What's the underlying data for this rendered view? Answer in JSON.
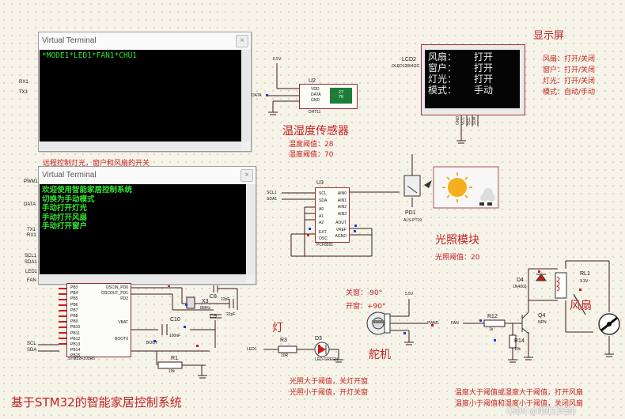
{
  "terminal1": {
    "title": "Virtual Terminal",
    "close": "×",
    "output": "*MODE1*LED1*FAN1*CHU1"
  },
  "terminal2": {
    "title": "Virtual Terminal",
    "close": "×",
    "lines": [
      "欢迎使用智能家居控制系统",
      "切换为手动模式",
      "手动打开灯光",
      "手动打开风扇",
      "手动打开窗户"
    ]
  },
  "notes": {
    "remote_control": "远程控制灯光，窗户和风扇的开关",
    "system_title": "基于STM32的智能家居控制系统",
    "display_title": "显示屏",
    "temp_sensor_title": "温湿度传感器",
    "temp_threshold": "温度阈值：28",
    "hum_threshold": "湿度阈值：70",
    "light_module_title": "光照模块",
    "light_threshold": "光照阈值：20",
    "lamp_title": "灯",
    "servo_title": "舵机",
    "close_window": "关窗：-90°",
    "open_window": "开窗：+90°",
    "light_rule_1": "光照大于阈值，关灯开窗",
    "light_rule_2": "光照小于阈值，开灯关窗",
    "fan_title": "风扇",
    "fan_rule_1": "温度大于阈值或湿度大于阈值，打开风扇",
    "fan_rule_2": "温度小于阈值和湿度小于阈值，关闭风扇",
    "watermark": "CSDN @科创工作室li"
  },
  "legend": [
    {
      "key": "风扇：",
      "val": "打开/关闭"
    },
    {
      "key": "窗户：",
      "val": "打开/关闭"
    },
    {
      "key": "灯光：",
      "val": "打开/关闭"
    },
    {
      "key": "模式：",
      "val": "自动/手动"
    }
  ],
  "lcd": {
    "ref": "LCD2",
    "part": "OLED12864I2C",
    "rows": [
      {
        "k": "风扇：",
        "v": "打开"
      },
      {
        "k": "窗户：",
        "v": "打开"
      },
      {
        "k": "灯光：",
        "v": "打开"
      },
      {
        "k": "模式：",
        "v": "手动"
      }
    ],
    "pins": [
      "GND",
      "VCC",
      "SCL",
      "SDA"
    ]
  },
  "dht": {
    "ref": "U2",
    "part": "DHT11",
    "pins": [
      "VDD",
      "DATA",
      "GND"
    ],
    "rail": "5.5V",
    "net": "DATA",
    "readout": [
      "27",
      "70"
    ]
  },
  "pcf": {
    "ref": "U3",
    "part": "PCF8591",
    "left_pins": [
      "SCL",
      "SDA",
      "A0",
      "A1",
      "A2",
      "EXT",
      "OSC"
    ],
    "right_pins": [
      "AIN0",
      "AIN1",
      "AIN2",
      "AIN3",
      "AOUT",
      "VREF",
      "AGND"
    ]
  },
  "photodiode": {
    "ref": "PD1",
    "part": "ALS-PT19"
  },
  "mcu": {
    "ref": "STM32F103R6",
    "pins_left": [
      "PB3",
      "PB4",
      "PB5",
      "PB6",
      "PB7",
      "PB8",
      "PB9",
      "PB10",
      "PB11",
      "PB12",
      "PB13",
      "PB14",
      "PB15"
    ],
    "pins_right": [
      "OSCIN_PD0",
      "OSCOUT_PD1",
      "PD2",
      "VBAT",
      "BOOT0"
    ]
  },
  "left_nets": [
    {
      "id": "rx1",
      "label": "RX1"
    },
    {
      "id": "tx1",
      "label": "TX1"
    },
    {
      "id": "pwm1",
      "label": "PWM1"
    },
    {
      "id": "data",
      "label": "DATA"
    },
    {
      "id": "tx1b",
      "label": "TX1"
    },
    {
      "id": "rx1b",
      "label": "RX1"
    },
    {
      "id": "scl1",
      "label": "SCL1"
    },
    {
      "id": "sda1",
      "label": "SDA1"
    },
    {
      "id": "led1",
      "label": "LED1"
    },
    {
      "id": "fan",
      "label": "FAN"
    },
    {
      "id": "scl",
      "label": "SCL"
    },
    {
      "id": "sda",
      "label": "SDA"
    }
  ],
  "pcf_nets": {
    "scl": "SCL1",
    "sda": "SDA1"
  },
  "components": {
    "x3": "X3",
    "x3_val": "8MHz",
    "c8": "C8",
    "c8_val": "22pF",
    "c9": "C9",
    "c9_val": "22pF",
    "c10": "C10",
    "c10_val": "100nF",
    "boot": "BOOT",
    "r1": "R1",
    "r1_val": "10k",
    "r3": "R3",
    "r3_val": "10R",
    "led_net": "LED1",
    "d3": "D3",
    "d3_part": "LED-GREEN",
    "servo_rail": "5.5V",
    "servo_net": "PWM1",
    "fan_net": "FAN",
    "r12": "R12",
    "r12_val": "1k",
    "r14": "R14",
    "r14_val": "10k",
    "q4": "Q4",
    "q4_part": "NPN",
    "d4": "D4",
    "d4_part": "1N4003",
    "rl1": "RL1",
    "rl1_val": "3.3V"
  }
}
